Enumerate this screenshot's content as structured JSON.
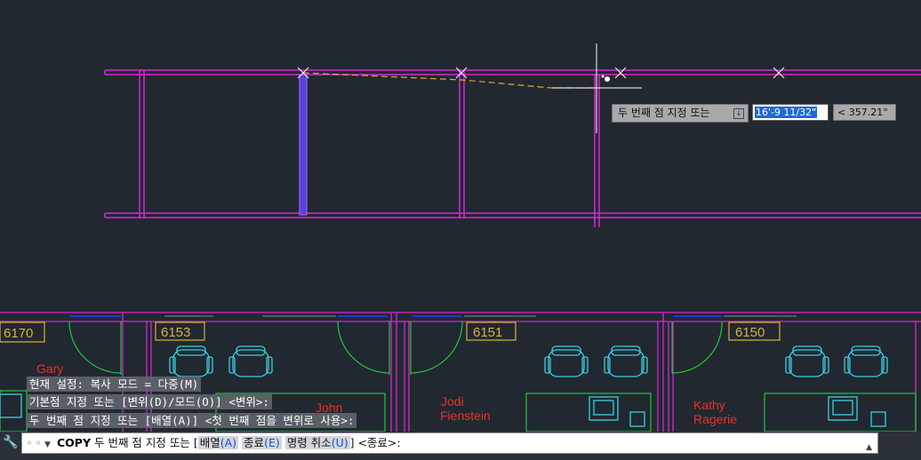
{
  "drawing": {
    "rooms": [
      {
        "number": "6170"
      },
      {
        "number": "6153"
      },
      {
        "number": "6151"
      },
      {
        "number": "6150"
      }
    ],
    "occupants": [
      {
        "line1": "Gary",
        "line2": ""
      },
      {
        "line1": "John",
        "line2": ""
      },
      {
        "line1": "Jodi",
        "line2": "Fienstein"
      },
      {
        "line1": "Kathy",
        "line2": "Ragerie"
      }
    ],
    "colors": {
      "background": "#212830",
      "magenta": "#d428d4",
      "blue": "#2b2fd6",
      "yellow": "#d8b23a",
      "cyan": "#3ad0e0",
      "green": "#22c83c",
      "red": "#e8302a",
      "crosshair": "#ffffff"
    }
  },
  "dynamic_input": {
    "prompt": "두 번째 점 지정 또는",
    "prompt_icon": "down-arrow-icon",
    "distance_value": "16'-9 11/32\"",
    "angle_value": "< 357.21°"
  },
  "command_history": [
    "현재 설정:  복사 모드 = 다중(M)",
    "기본점 지정 또는 [변위(D)/모드(O)] <변위>:",
    "두 번째 점 지정 또는 [배열(A)] <첫 번째 점을 변위로 사용>:"
  ],
  "command_line": {
    "command": "COPY",
    "prompt": "두 번째 점 지정 또는 [",
    "options": [
      {
        "label": "배열",
        "key": "(A)"
      },
      {
        "label": "종료",
        "key": "(E)"
      },
      {
        "label": "명령 취소",
        "key": "(U)"
      }
    ],
    "suffix": "] <종료>:",
    "icons": [
      "wrench-icon",
      "command-icon",
      "dropdown-arrow-icon",
      "scroll-up-icon"
    ]
  }
}
